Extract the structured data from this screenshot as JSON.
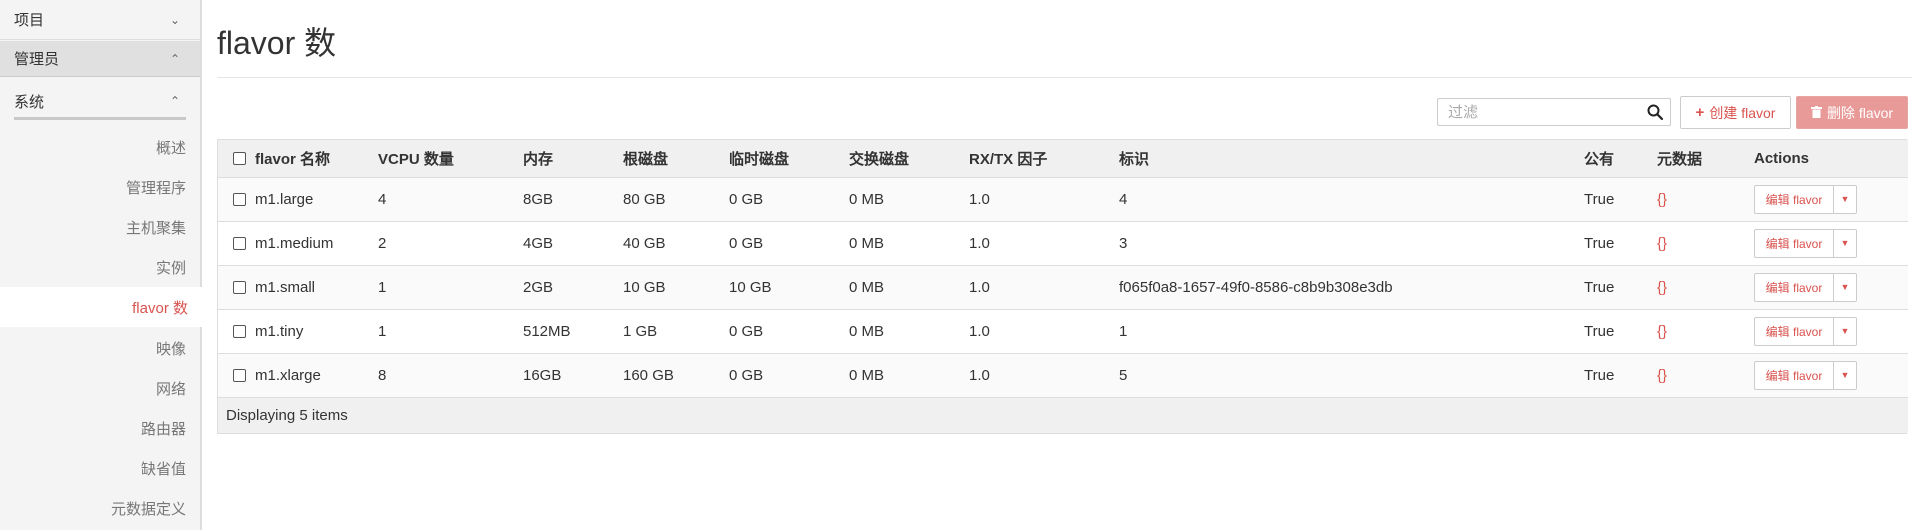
{
  "sidebar": {
    "project": {
      "label": "项目",
      "chevron": "chevron-down-icon"
    },
    "admin": {
      "label": "管理员",
      "chevron": "chevron-up-icon"
    },
    "system": {
      "label": "系统",
      "chevron": "chevron-up-icon"
    },
    "items": [
      {
        "label": "概述",
        "active": false
      },
      {
        "label": "管理程序",
        "active": false
      },
      {
        "label": "主机聚集",
        "active": false
      },
      {
        "label": "实例",
        "active": false
      },
      {
        "label": "flavor 数",
        "active": true
      },
      {
        "label": "映像",
        "active": false
      },
      {
        "label": "网络",
        "active": false
      },
      {
        "label": "路由器",
        "active": false
      },
      {
        "label": "缺省值",
        "active": false
      },
      {
        "label": "元数据定义",
        "active": false
      }
    ]
  },
  "page": {
    "title": "flavor 数"
  },
  "toolbar": {
    "filter_placeholder": "过滤",
    "create_label": "创建 flavor",
    "delete_label": "删除 flavor"
  },
  "table": {
    "headers": {
      "name": "flavor 名称",
      "vcpu": "VCPU 数量",
      "ram": "内存",
      "root_disk": "根磁盘",
      "ephemeral": "临时磁盘",
      "swap": "交换磁盘",
      "rxtx": "RX/TX 因子",
      "id": "标识",
      "public": "公有",
      "metadata": "元数据",
      "actions": "Actions"
    },
    "rows": [
      {
        "name": "m1.large",
        "vcpu": "4",
        "ram": "8GB",
        "root_disk": "80 GB",
        "ephemeral": "0 GB",
        "swap": "0 MB",
        "rxtx": "1.0",
        "id": "4",
        "public": "True",
        "metadata": "{}",
        "action": "编辑 flavor"
      },
      {
        "name": "m1.medium",
        "vcpu": "2",
        "ram": "4GB",
        "root_disk": "40 GB",
        "ephemeral": "0 GB",
        "swap": "0 MB",
        "rxtx": "1.0",
        "id": "3",
        "public": "True",
        "metadata": "{}",
        "action": "编辑 flavor"
      },
      {
        "name": "m1.small",
        "vcpu": "1",
        "ram": "2GB",
        "root_disk": "10 GB",
        "ephemeral": "10 GB",
        "swap": "0 MB",
        "rxtx": "1.0",
        "id": "f065f0a8-1657-49f0-8586-c8b9b308e3db",
        "public": "True",
        "metadata": "{}",
        "action": "编辑 flavor"
      },
      {
        "name": "m1.tiny",
        "vcpu": "1",
        "ram": "512MB",
        "root_disk": "1 GB",
        "ephemeral": "0 GB",
        "swap": "0 MB",
        "rxtx": "1.0",
        "id": "1",
        "public": "True",
        "metadata": "{}",
        "action": "编辑 flavor"
      },
      {
        "name": "m1.xlarge",
        "vcpu": "8",
        "ram": "16GB",
        "root_disk": "160 GB",
        "ephemeral": "0 GB",
        "swap": "0 MB",
        "rxtx": "1.0",
        "id": "5",
        "public": "True",
        "metadata": "{}",
        "action": "编辑 flavor"
      }
    ],
    "footer": "Displaying 5 items"
  },
  "colors": {
    "accent": "#d9534f",
    "delete_bg": "#e89a98"
  }
}
